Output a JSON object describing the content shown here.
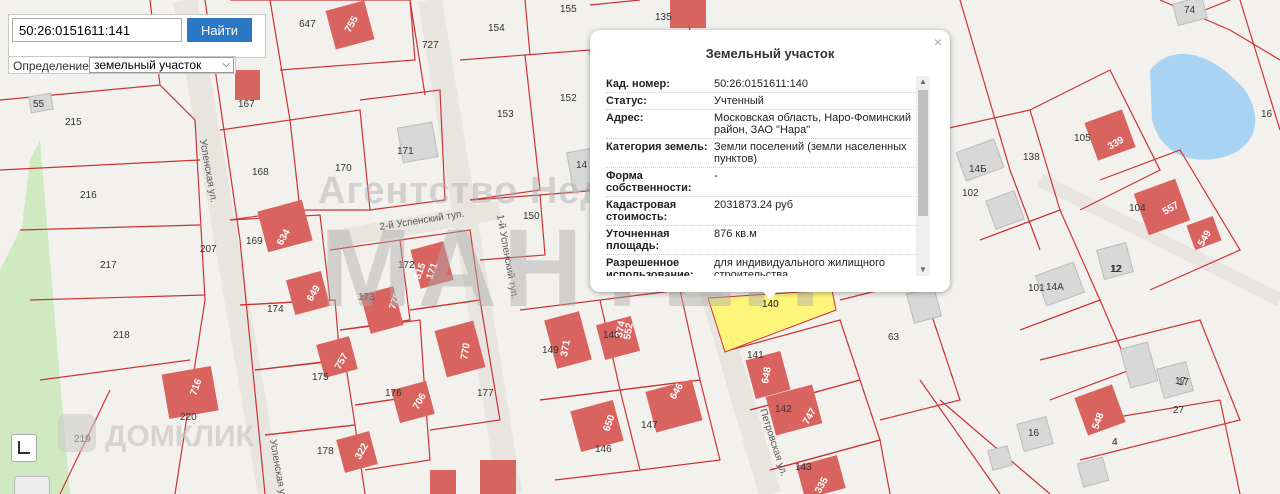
{
  "search": {
    "value": "50:26:0151611:141",
    "button_label": "Найти"
  },
  "definition": {
    "label": "Определение:",
    "selected": "земельный участок"
  },
  "popup": {
    "title": "Земельный участок",
    "close_symbol": "×",
    "rows": [
      {
        "key": "Кад. номер:",
        "value": "50:26:0151611:140"
      },
      {
        "key": "Статус:",
        "value": "Учтенный"
      },
      {
        "key": "Адрес:",
        "value": "Московская область, Наро-Фоминский район, ЗАО \"Нара\""
      },
      {
        "key": "Категория земель:",
        "value": "Земли поселений (земли населенных пунктов)"
      },
      {
        "key": "Форма собственности:",
        "value": "-"
      },
      {
        "key": "Кадастровая стоимость:",
        "value": "2031873.24 руб"
      },
      {
        "key": "Уточненная площадь:",
        "value": "876 кв.м"
      },
      {
        "key": "Разрешенное использование:",
        "value": "для индивидуального жилищного строительства"
      }
    ]
  },
  "watermarks": {
    "agency": "Агентство Недвижимости",
    "brand": "МАНТЕН",
    "domclick": "ДОМКЛИК"
  },
  "map": {
    "colors": {
      "background": "#f3f1ee",
      "parcel_border": "#cc3333",
      "building": "#d9645f",
      "selected_parcel": "#fff57a",
      "water": "#a9d3f2",
      "green": "#cfeac0",
      "grey_building": "#d8d8d8"
    },
    "streets": [
      "2-й Успенский туп.",
      "Успенская ул.",
      "1-й Успенский туп.",
      "Петровская ул."
    ],
    "plot_numbers": [
      "215",
      "216",
      "217",
      "218",
      "219",
      "207",
      "167",
      "168",
      "169",
      "170",
      "171",
      "172",
      "173",
      "174",
      "175",
      "176",
      "177",
      "178",
      "220",
      "153",
      "152",
      "150",
      "149",
      "148",
      "147",
      "146",
      "154",
      "727",
      "647",
      "155",
      "135",
      "141",
      "142",
      "143",
      "140",
      "63",
      "105",
      "102",
      "101",
      "104",
      "138",
      "16",
      "17",
      "27",
      "12",
      "74",
      "4",
      "55"
    ],
    "building_numbers": [
      "755",
      "634",
      "615",
      "649",
      "757",
      "706",
      "322",
      "716",
      "171",
      "775",
      "770",
      "371",
      "374",
      "646",
      "650",
      "648",
      "747",
      "335",
      "339",
      "557",
      "549",
      "548",
      "552"
    ],
    "grey_labels": [
      "14Б",
      "14А",
      "12",
      "16",
      "17",
      "4",
      "14"
    ],
    "selected_label": "140"
  },
  "icons": {
    "layers": "layers-icon",
    "zoom": "zoom-icon"
  }
}
